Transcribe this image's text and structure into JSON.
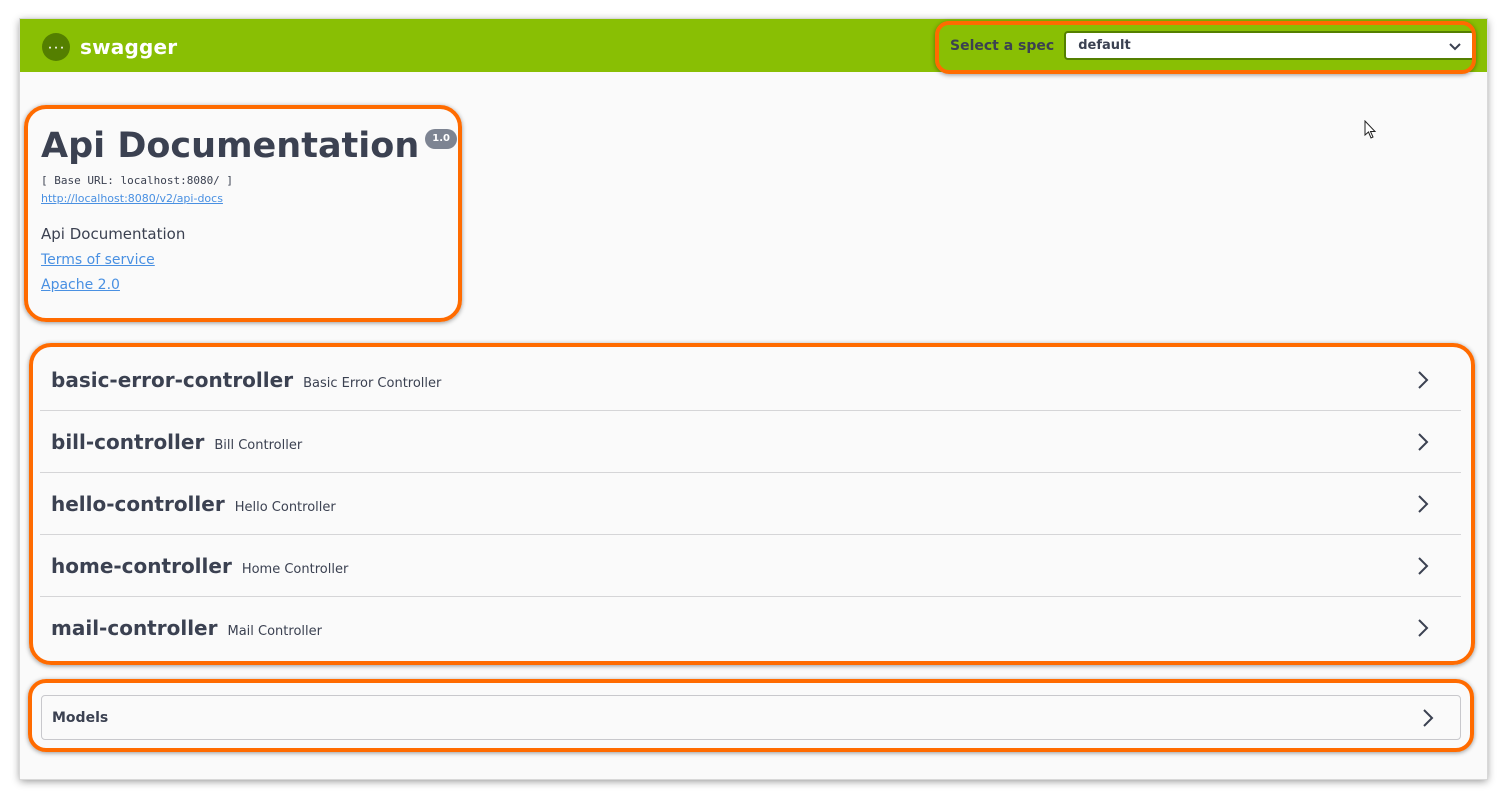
{
  "header": {
    "brand": "swagger",
    "spec_label": "Select a spec",
    "spec_value": "default"
  },
  "info": {
    "title": "Api Documentation",
    "version": "1.0",
    "base_url": "[ Base URL: localhost:8080/ ]",
    "api_docs_link": "http://localhost:8080/v2/api-docs",
    "description": "Api Documentation",
    "terms_link": "Terms of service",
    "license_link": "Apache 2.0"
  },
  "tags": [
    {
      "name": "basic-error-controller",
      "description": "Basic Error Controller"
    },
    {
      "name": "bill-controller",
      "description": "Bill Controller"
    },
    {
      "name": "hello-controller",
      "description": "Hello Controller"
    },
    {
      "name": "home-controller",
      "description": "Home Controller"
    },
    {
      "name": "mail-controller",
      "description": "Mail Controller"
    }
  ],
  "models": {
    "title": "Models"
  },
  "colors": {
    "topbar": "#89bf04",
    "highlight": "#ff6b00",
    "link": "#4990e2",
    "text": "#3b4151"
  },
  "icons": [
    "swagger-logo-icon",
    "chevron-down-icon",
    "chevron-right-icon",
    "mouse-cursor-icon"
  ]
}
